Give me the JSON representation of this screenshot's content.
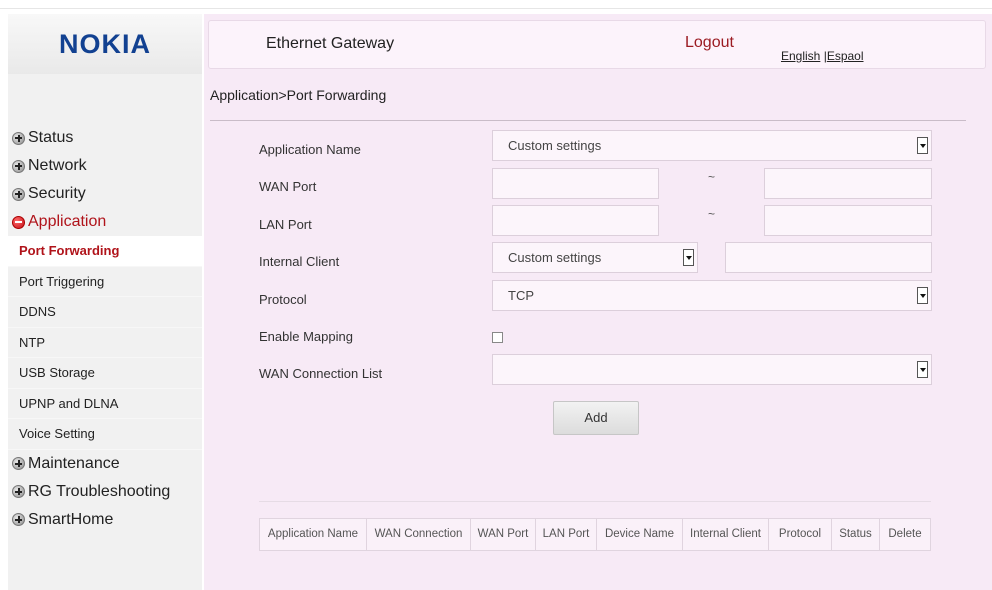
{
  "brand": {
    "logo": "NOKIA"
  },
  "header": {
    "title": "Ethernet Gateway",
    "logout": "Logout",
    "lang_english": "English",
    "lang_sep": " |",
    "lang_spanish": "Espaol"
  },
  "breadcrumb": "Application>Port Forwarding",
  "menu": {
    "status": "Status",
    "network": "Network",
    "security": "Security",
    "application": "Application",
    "sub": [
      "Port Forwarding",
      "Port Triggering",
      "DDNS",
      "NTP",
      "USB Storage",
      "UPNP and DLNA",
      "Voice Setting"
    ],
    "maintenance": "Maintenance",
    "rg_troubleshooting": "RG Troubleshooting",
    "smarthome": "SmartHome"
  },
  "form": {
    "application_name_label": "Application Name",
    "application_name_value": "Custom settings",
    "wan_port_label": "WAN Port",
    "wan_port_start": "",
    "wan_port_end": "",
    "lan_port_label": "LAN Port",
    "lan_port_start": "",
    "lan_port_end": "",
    "range_sep": "~",
    "internal_client_label": "Internal Client",
    "internal_client_select": "Custom settings",
    "internal_client_value": "",
    "protocol_label": "Protocol",
    "protocol_value": "TCP",
    "enable_mapping_label": "Enable Mapping",
    "enable_mapping_checked": false,
    "wan_connection_list_label": "WAN Connection List",
    "wan_connection_list_value": "",
    "add_label": "Add"
  },
  "table": {
    "columns": [
      "Application Name",
      "WAN Connection",
      "WAN Port",
      "LAN Port",
      "Device Name",
      "Internal Client",
      "Protocol",
      "Status",
      "Delete"
    ],
    "rows": []
  },
  "colors": {
    "brand": "#124191",
    "accent": "#b0131a",
    "panel": "#f7eaf6"
  }
}
